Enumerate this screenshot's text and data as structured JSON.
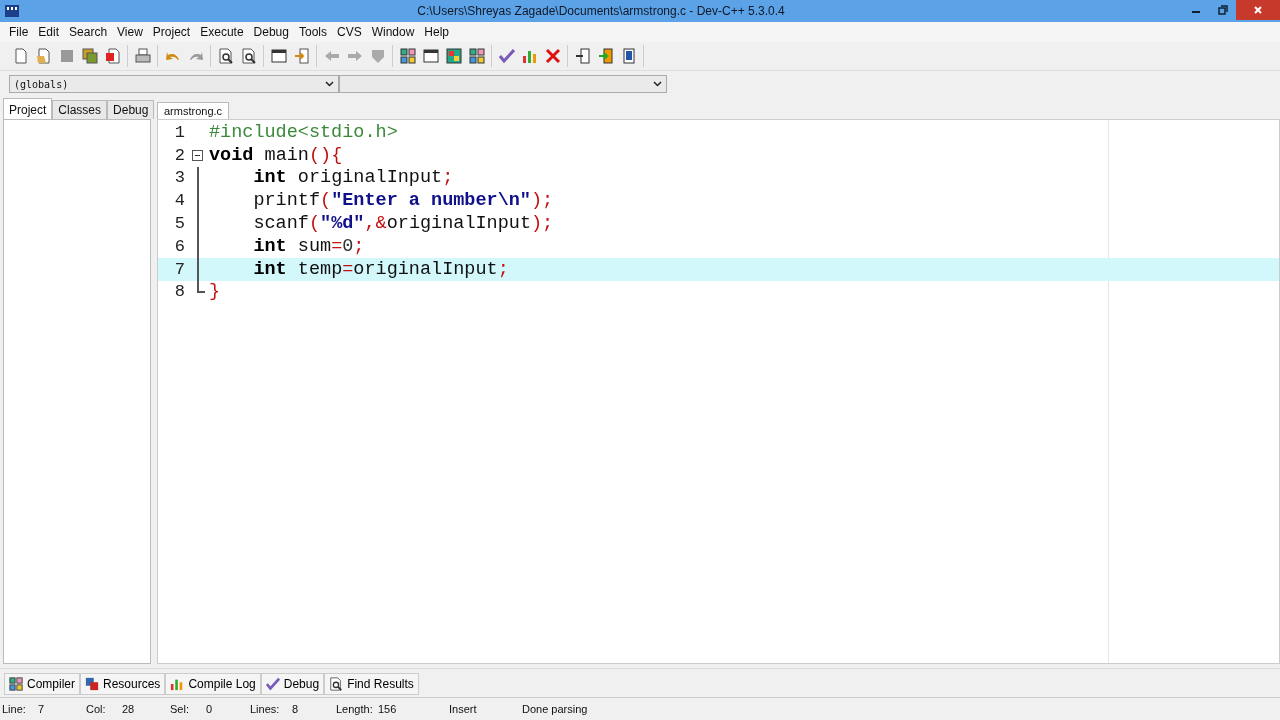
{
  "window": {
    "title": "C:\\Users\\Shreyas Zagade\\Documents\\armstrong.c - Dev-C++ 5.3.0.4"
  },
  "menu": [
    "File",
    "Edit",
    "Search",
    "View",
    "Project",
    "Execute",
    "Debug",
    "Tools",
    "CVS",
    "Window",
    "Help"
  ],
  "scope_selector": {
    "value": "(globals)"
  },
  "side_tabs": [
    {
      "label": "Project",
      "selected": true
    },
    {
      "label": "Classes",
      "selected": false
    },
    {
      "label": "Debug",
      "selected": false
    }
  ],
  "editor_tabs": [
    {
      "label": "armstrong.c",
      "selected": true
    }
  ],
  "code_lines": [
    {
      "number": "1",
      "current": false,
      "tokens": [
        {
          "kind": "preproc",
          "text": "#include<stdio.h>"
        }
      ]
    },
    {
      "number": "2",
      "current": false,
      "expanded": true,
      "tokens": [
        {
          "kind": "keyword",
          "text": "void"
        },
        {
          "kind": "ident",
          "text": " main"
        },
        {
          "kind": "symbol",
          "text": "(){"
        }
      ]
    },
    {
      "number": "3",
      "current": false,
      "tokens": [
        {
          "kind": "keyword",
          "text": "    int"
        },
        {
          "kind": "ident",
          "text": " originalInput"
        },
        {
          "kind": "symbol",
          "text": ";"
        }
      ]
    },
    {
      "number": "4",
      "current": false,
      "tokens": [
        {
          "kind": "ident",
          "text": "    printf"
        },
        {
          "kind": "symbol",
          "text": "("
        },
        {
          "kind": "string",
          "text": "\"Enter a number\\n\""
        },
        {
          "kind": "symbol",
          "text": ");"
        }
      ]
    },
    {
      "number": "5",
      "current": false,
      "tokens": [
        {
          "kind": "ident",
          "text": "    scanf"
        },
        {
          "kind": "symbol",
          "text": "("
        },
        {
          "kind": "string",
          "text": "\"%d\""
        },
        {
          "kind": "symbol",
          "text": ",&"
        },
        {
          "kind": "ident",
          "text": "originalInput"
        },
        {
          "kind": "symbol",
          "text": ");"
        }
      ]
    },
    {
      "number": "6",
      "current": false,
      "tokens": [
        {
          "kind": "keyword",
          "text": "    int"
        },
        {
          "kind": "ident",
          "text": " sum"
        },
        {
          "kind": "symbol",
          "text": "="
        },
        {
          "kind": "number",
          "text": "0"
        },
        {
          "kind": "symbol",
          "text": ";"
        }
      ]
    },
    {
      "number": "7",
      "current": true,
      "tokens": [
        {
          "kind": "keyword",
          "text": "    int"
        },
        {
          "kind": "ident",
          "text": " temp"
        },
        {
          "kind": "symbol",
          "text": "="
        },
        {
          "kind": "ident",
          "text": "originalInput"
        },
        {
          "kind": "symbol",
          "text": ";"
        }
      ]
    },
    {
      "number": "8",
      "current": false,
      "tokens": [
        {
          "kind": "symbol",
          "text": "}"
        }
      ]
    }
  ],
  "bottom_tabs": [
    {
      "label": "Compiler",
      "kind": "compiler"
    },
    {
      "label": "Resources",
      "kind": "resources"
    },
    {
      "label": "Compile Log",
      "kind": "log"
    },
    {
      "label": "Debug",
      "kind": "debug"
    },
    {
      "label": "Find Results",
      "kind": "find"
    }
  ],
  "status_bar": {
    "fields": [
      {
        "label": "Line:",
        "value": "7"
      },
      {
        "label": "Col:",
        "value": "28"
      },
      {
        "label": "Sel:",
        "value": "0"
      },
      {
        "label": "Lines:",
        "value": "8"
      },
      {
        "label": "Length:",
        "value": "156"
      }
    ],
    "mode": "Insert",
    "message": "Done parsing"
  }
}
